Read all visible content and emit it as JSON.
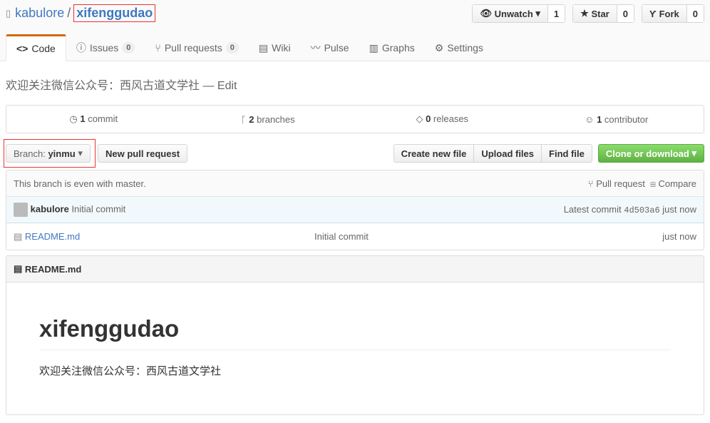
{
  "repo": {
    "owner": "kabulore",
    "name": "xifenggudao"
  },
  "actions": {
    "watch": "Unwatch",
    "watch_count": "1",
    "star": "Star",
    "star_count": "0",
    "fork": "Fork",
    "fork_count": "0"
  },
  "tabs": [
    {
      "label": "Code"
    },
    {
      "label": "Issues",
      "count": "0"
    },
    {
      "label": "Pull requests",
      "count": "0"
    },
    {
      "label": "Wiki"
    },
    {
      "label": "Pulse"
    },
    {
      "label": "Graphs"
    },
    {
      "label": "Settings"
    }
  ],
  "description": "欢迎关注微信公众号：西风古道文学社",
  "edit": "— Edit",
  "summary": {
    "commits": "1",
    "commits_label": "commit",
    "branches": "2",
    "branches_label": "branches",
    "releases": "0",
    "releases_label": "releases",
    "contributors": "1",
    "contributors_label": "contributor"
  },
  "branch": {
    "label": "Branch:",
    "name": "yinmu"
  },
  "buttons": {
    "new_pr": "New pull request",
    "create": "Create new file",
    "upload": "Upload files",
    "find": "Find file",
    "clone": "Clone or download"
  },
  "status": {
    "text": "This branch is even with master.",
    "pr": "Pull request",
    "compare": "Compare"
  },
  "commit": {
    "author": "kabulore",
    "message": "Initial commit",
    "latest": "Latest commit",
    "sha": "4d503a6",
    "time": "just now"
  },
  "files": [
    {
      "name": "README.md",
      "message": "Initial commit",
      "time": "just now"
    }
  ],
  "readme": {
    "header": "README.md",
    "title": "xifenggudao",
    "body": "欢迎关注微信公众号：西风古道文学社"
  }
}
